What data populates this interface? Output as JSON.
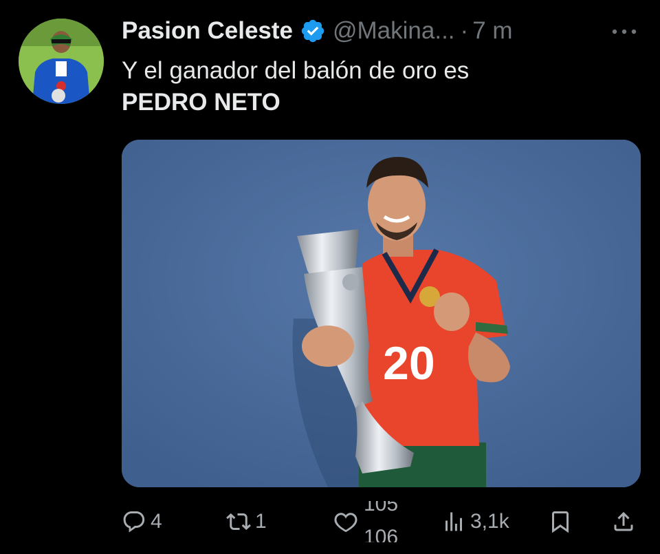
{
  "tweet": {
    "display_name": "Pasion Celeste",
    "handle": "@Makina...",
    "dot": "·",
    "time": "7 m",
    "text_line1": "Y el ganador del balón de oro es",
    "text_line2": "PEDRO NETO",
    "verified_icon": "verified-badge-icon",
    "more_icon": "more-options-icon"
  },
  "media": {
    "shirt_number": "20"
  },
  "actions": {
    "reply_count": "4",
    "retweet_count": "1",
    "like_count_old": "105",
    "like_count_new": "106",
    "views_count": "3,1k"
  },
  "colors": {
    "background": "#000000",
    "text_primary": "#e7e9ea",
    "text_secondary": "#71767b",
    "verified_blue": "#1d9bf0",
    "photo_backdrop": "#4a6a99"
  }
}
